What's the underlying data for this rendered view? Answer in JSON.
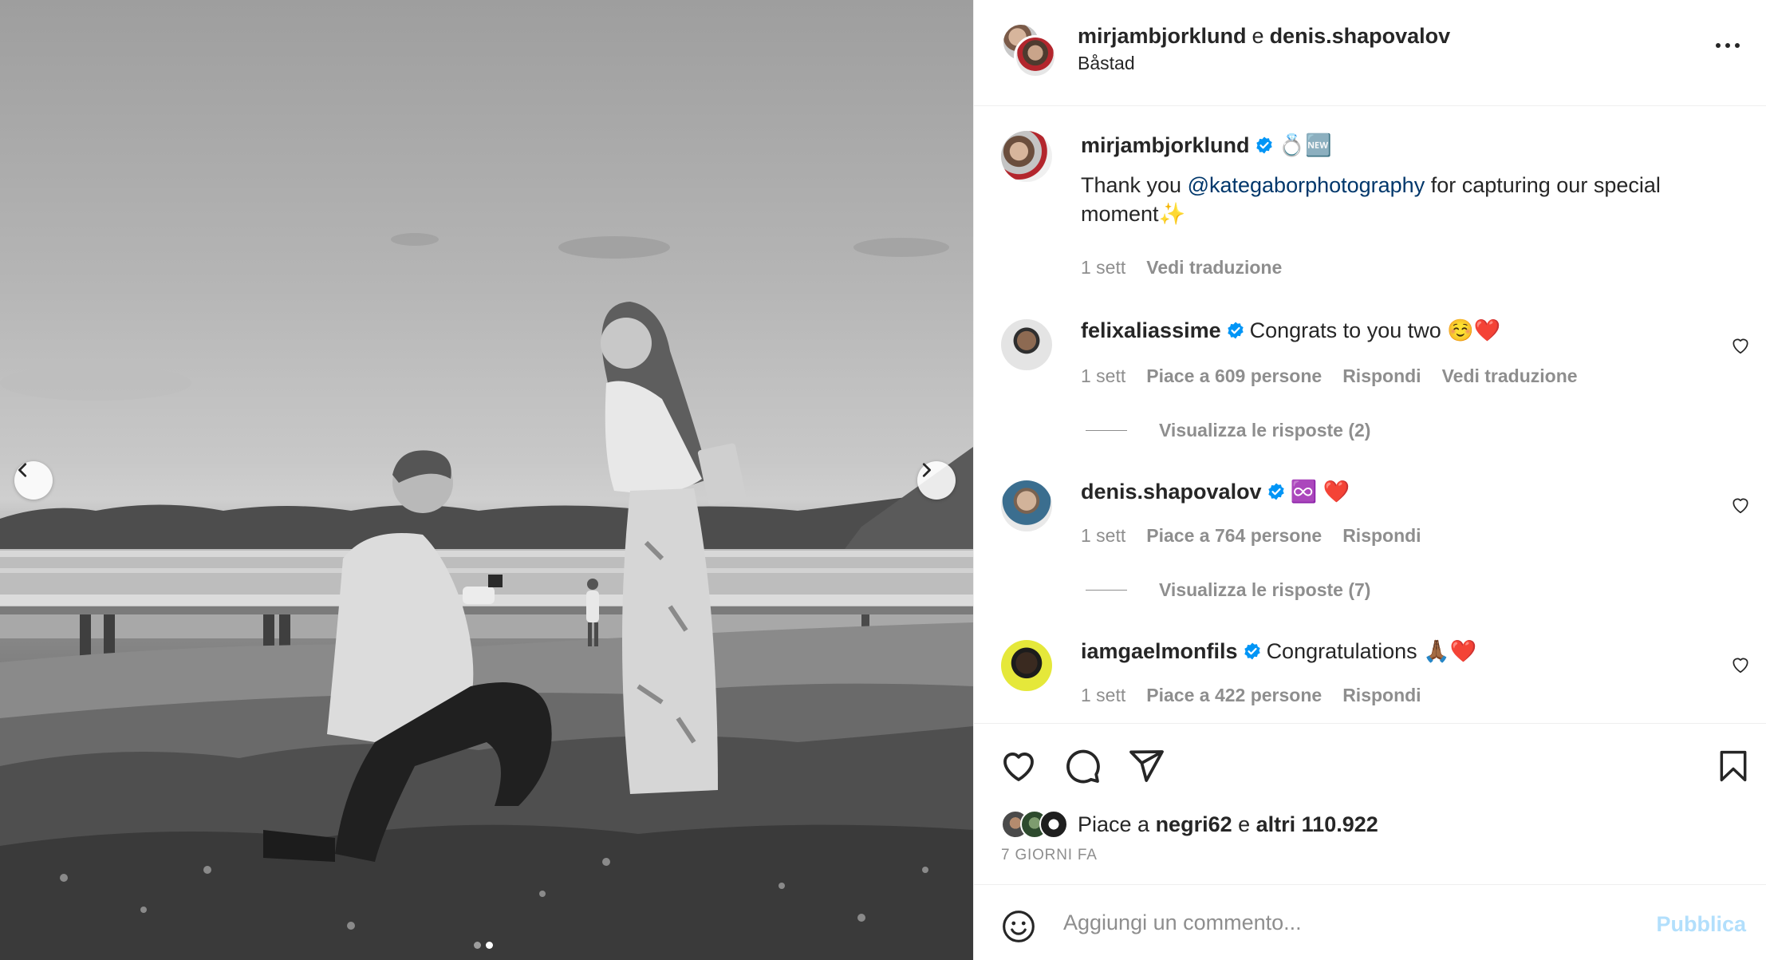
{
  "post": {
    "author1": "mirjambjorklund",
    "connector": "e",
    "author2": "denis.shapovalov",
    "location": "Båstad"
  },
  "caption": {
    "username": "mirjambjorklund",
    "emoji": "💍🆕",
    "text_before": "Thank you ",
    "mention": "@kategaborphotography",
    "text_after": " for capturing our special moment✨",
    "time": "1 sett",
    "translate": "Vedi traduzione"
  },
  "comments": [
    {
      "username": "felixaliassime",
      "text": "Congrats to you two ☺️❤️",
      "time": "1 sett",
      "likes": "Piace a 609 persone",
      "reply": "Rispondi",
      "translate": "Vedi traduzione",
      "view_replies": "Visualizza le risposte (2)"
    },
    {
      "username": "denis.shapovalov",
      "text": "♾️ ❤️",
      "time": "1 sett",
      "likes": "Piace a 764 persone",
      "reply": "Rispondi",
      "view_replies": "Visualizza le risposte (7)"
    },
    {
      "username": "iamgaelmonfils",
      "text": "Congratulations 🙏🏾❤️",
      "time": "1 sett",
      "likes": "Piace a 422 persone",
      "reply": "Rispondi"
    }
  ],
  "likes_summary": {
    "prefix": "Piace a ",
    "user": "negri62",
    "connector": " e ",
    "others": "altri 110.922"
  },
  "posted_ago": "7 GIORNI FA",
  "comment_box": {
    "placeholder": "Aggiungi un commento...",
    "publish": "Pubblica"
  },
  "icons": {
    "like": "heart-icon",
    "comment": "comment-icon",
    "share": "send-icon",
    "save": "bookmark-icon",
    "emoji": "smiley-icon",
    "more": "more-dots-icon",
    "verified": "verified-badge-icon",
    "prev": "chevron-left-icon",
    "next": "chevron-right-icon"
  },
  "colors": {
    "verified": "#0095f6",
    "mention": "#00376b",
    "muted": "#8e8e8e",
    "publish_disabled": "#b2dffc"
  },
  "carousel": {
    "slides": 2,
    "active": 2
  }
}
